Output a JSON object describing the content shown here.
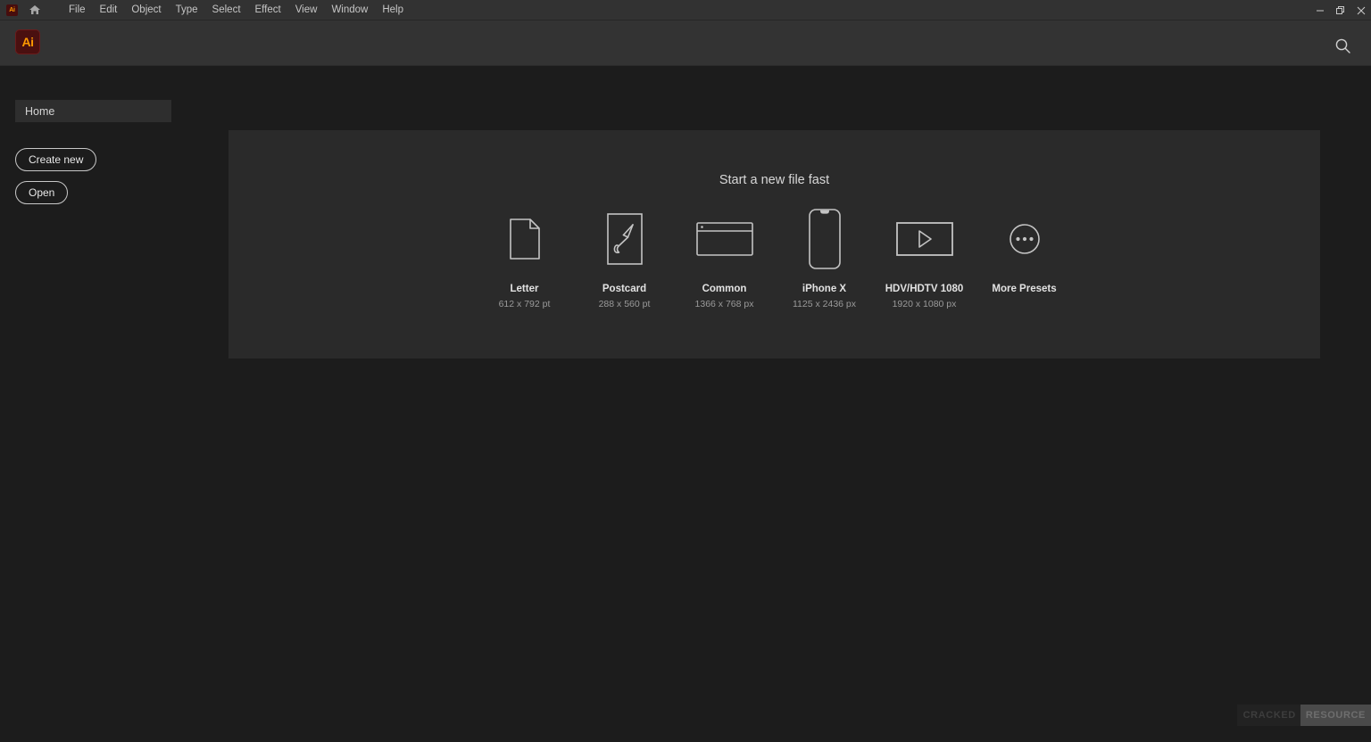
{
  "window": {
    "app_badge": "Ai",
    "menus": [
      "File",
      "Edit",
      "Object",
      "Type",
      "Select",
      "Effect",
      "View",
      "Window",
      "Help"
    ],
    "controls": {
      "minimize": "–",
      "restore": "❐",
      "close": "✕"
    }
  },
  "header": {
    "logo_text": "Ai",
    "search_icon": "search-icon"
  },
  "sidebar": {
    "nav": [
      {
        "label": "Home",
        "selected": true
      }
    ],
    "buttons": [
      {
        "label": "Create new"
      },
      {
        "label": "Open"
      }
    ]
  },
  "main": {
    "title": "Start a new file fast",
    "presets": [
      {
        "name": "Letter",
        "size": "612 x 792 pt",
        "icon": "document-page-icon"
      },
      {
        "name": "Postcard",
        "size": "288 x 560 pt",
        "icon": "paintbrush-card-icon"
      },
      {
        "name": "Common",
        "size": "1366 x 768 px",
        "icon": "browser-window-icon"
      },
      {
        "name": "iPhone X",
        "size": "1125 x 2436 px",
        "icon": "phone-device-icon"
      },
      {
        "name": "HDV/HDTV 1080",
        "size": "1920 x 1080 px",
        "icon": "video-play-icon"
      },
      {
        "name": "More Presets",
        "size": "",
        "icon": "ellipsis-circle-icon"
      }
    ]
  },
  "watermark": {
    "part1": "CRACKED",
    "part2": "RESOURCE"
  },
  "colors": {
    "page_bg": "#1c1c1c",
    "menubar_bg": "#323232",
    "header_bg": "#333333",
    "panel_bg": "#2a2a2a",
    "accent_orange": "#ff9a00",
    "logo_maroon": "#4a1010",
    "text_primary": "#e2e2e2",
    "text_secondary": "#9a9a9a"
  }
}
